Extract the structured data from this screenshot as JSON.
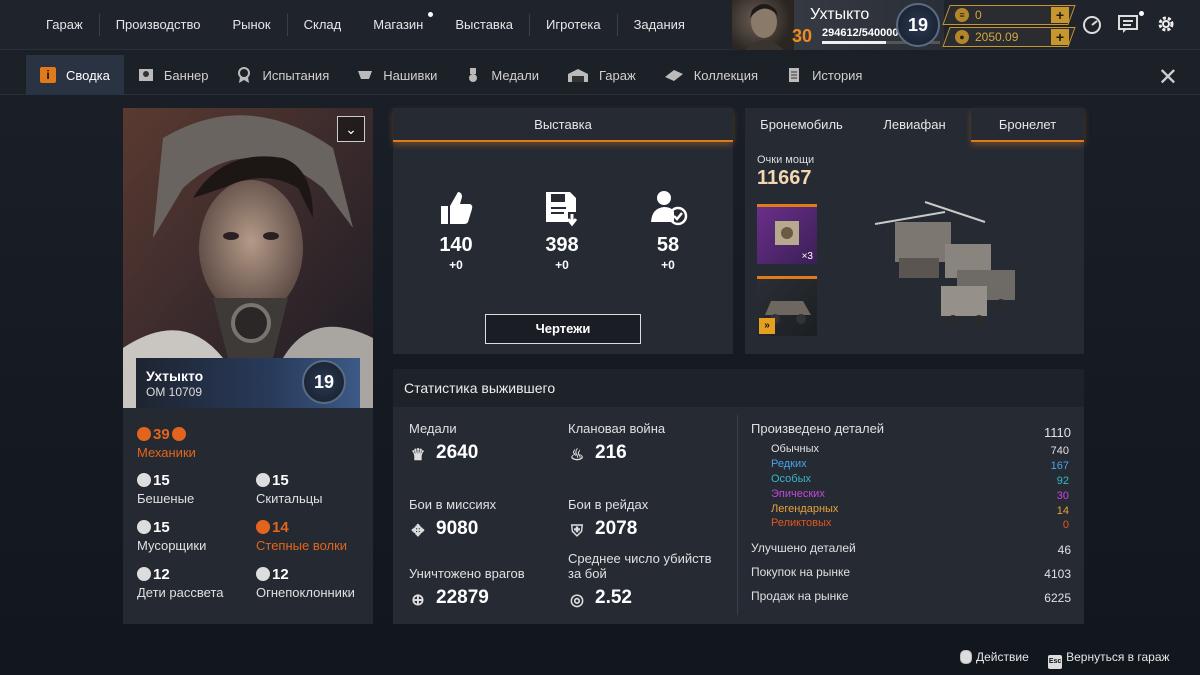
{
  "top_nav": [
    "Гараж",
    "Производство",
    "Рынок",
    "Склад",
    "Магазин",
    "Выставка",
    "Игротека",
    "Задания"
  ],
  "profile": {
    "name": "Ухтыкто",
    "level": "30",
    "xp": "294612/540000",
    "xp_fraction": 0.545,
    "rank_badge": "19"
  },
  "currencies": [
    {
      "icon": "coupon-icon",
      "value": "0"
    },
    {
      "icon": "coin-icon",
      "value": "2050.09"
    }
  ],
  "top_icons": [
    "speedometer-icon",
    "chat-icon",
    "gear-icon"
  ],
  "tabs": [
    {
      "label": "Сводка",
      "icon": "info-icon",
      "active": true
    },
    {
      "label": "Баннер",
      "icon": "banner-icon"
    },
    {
      "label": "Испытания",
      "icon": "challenge-icon"
    },
    {
      "label": "Нашивки",
      "icon": "patch-icon"
    },
    {
      "label": "Медали",
      "icon": "medal-icon"
    },
    {
      "label": "Гараж",
      "icon": "garage-icon"
    },
    {
      "label": "Коллекция",
      "icon": "collection-icon"
    },
    {
      "label": "История",
      "icon": "history-icon"
    }
  ],
  "character": {
    "name": "Ухтыкто",
    "om": "ОМ 10709",
    "level": "19",
    "factions": [
      {
        "name": "Механики",
        "value": "39",
        "color": "#e2651e"
      },
      {
        "name": "Бешеные",
        "value": "15"
      },
      {
        "name": "Скитальцы",
        "value": "15"
      },
      {
        "name": "Мусорщики",
        "value": "15"
      },
      {
        "name": "Степные волки",
        "value": "14",
        "color": "#e2651e"
      },
      {
        "name": "Дети рассвета",
        "value": "12"
      },
      {
        "name": "Огнепоклонники",
        "value": "12"
      }
    ]
  },
  "exhibition": {
    "title": "Выставка",
    "stats": [
      {
        "icon": "thumbs-up-icon",
        "value": "140",
        "delta": "+0"
      },
      {
        "icon": "blueprint-save-icon",
        "value": "398",
        "delta": "+0"
      },
      {
        "icon": "user-check-icon",
        "value": "58",
        "delta": "+0"
      }
    ],
    "button": "Чертежи"
  },
  "vehicles": {
    "tabs": [
      "Бронемобиль",
      "Левиафан",
      "Бронелет"
    ],
    "active_tab": 2,
    "power_label": "Очки мощи",
    "power_value": "11667",
    "cards": [
      {
        "badge": "×3"
      },
      {
        "badge": ""
      }
    ]
  },
  "survivor_stats": {
    "title": "Статистика выжившего",
    "left": [
      {
        "label": "Медали",
        "value": "2640",
        "icon": "medal-icon"
      },
      {
        "label": "Клановая война",
        "value": "216",
        "icon": "fire-icon"
      },
      {
        "label": "Бои в миссиях",
        "value": "9080",
        "icon": "mission-icon"
      },
      {
        "label": "Бои в рейдах",
        "value": "2078",
        "icon": "raid-icon"
      },
      {
        "label": "Уничтожено врагов",
        "value": "22879",
        "icon": "crosshair-icon"
      },
      {
        "label": "Среднее число убийств за бой",
        "value": "2.52",
        "icon": "kills-icon"
      }
    ],
    "produced": {
      "label": "Произведено деталей",
      "value": "1110"
    },
    "rarities": [
      {
        "label": "Обычных",
        "value": "740",
        "color": "#e0e0e0"
      },
      {
        "label": "Редких",
        "value": "167",
        "color": "#4aa3e8"
      },
      {
        "label": "Особых",
        "value": "92",
        "color": "#39b6c8"
      },
      {
        "label": "Эпических",
        "value": "30",
        "color": "#c447d9"
      },
      {
        "label": "Легендарных",
        "value": "14",
        "color": "#e8a23a"
      },
      {
        "label": "Реликтовых",
        "value": "0",
        "color": "#e2571e"
      }
    ],
    "other": [
      {
        "label": "Улучшено деталей",
        "value": "46"
      },
      {
        "label": "Покупок на рынке",
        "value": "4103"
      },
      {
        "label": "Продаж на рынке",
        "value": "6225"
      }
    ]
  },
  "footer": {
    "action": "Действие",
    "back": "Вернуться в гараж",
    "esc_key": "Esc"
  },
  "colors": {
    "accent": "#e07a1a",
    "gold": "#c7962d",
    "panel": "#252a33"
  }
}
